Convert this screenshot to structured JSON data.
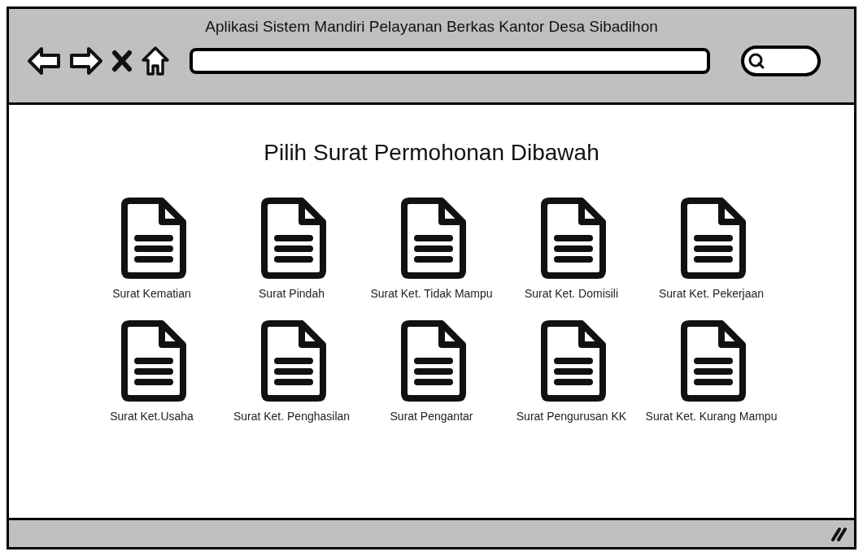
{
  "window": {
    "title": "Aplikasi Sistem Mandiri Pelayanan Berkas Kantor Desa Sibadihon"
  },
  "heading": "Pilih Surat Permohonan Dibawah",
  "documents": [
    {
      "label": "Surat Kematian"
    },
    {
      "label": "Surat Pindah"
    },
    {
      "label": "Surat Ket. Tidak Mampu"
    },
    {
      "label": "Surat Ket. Domisili"
    },
    {
      "label": "Surat Ket. Pekerjaan"
    },
    {
      "label": "Surat Ket.Usaha"
    },
    {
      "label": "Surat Ket. Penghasilan"
    },
    {
      "label": "Surat Pengantar"
    },
    {
      "label": "Surat Pengurusan KK"
    },
    {
      "label": "Surat Ket. Kurang Mampu"
    }
  ]
}
